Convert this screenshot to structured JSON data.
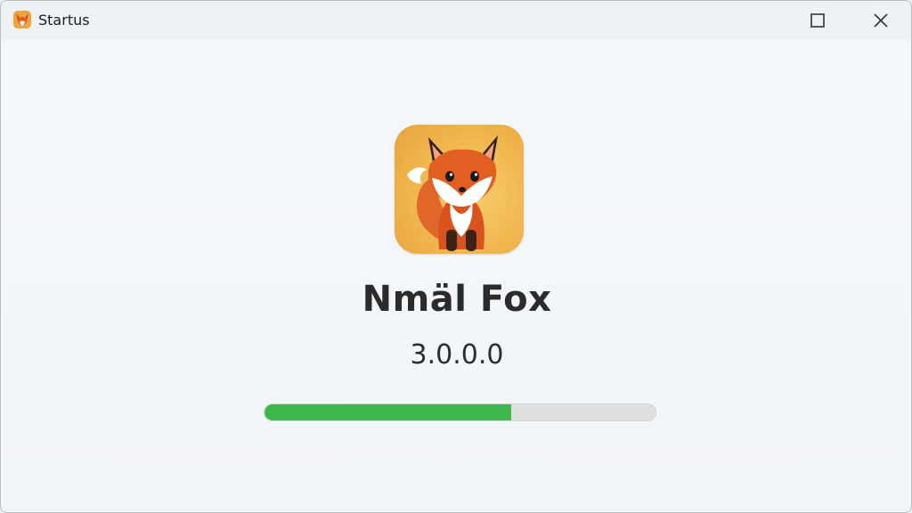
{
  "window": {
    "title": "Startus",
    "app_icon": "fox-icon",
    "controls": [
      "maximize-icon",
      "close-icon"
    ]
  },
  "splash": {
    "logo": "fox-logo",
    "app_name": "Nmäl Fox",
    "version": "3.0.0.0",
    "progress_fraction": 0.63,
    "progress_color": "#3db64a"
  }
}
